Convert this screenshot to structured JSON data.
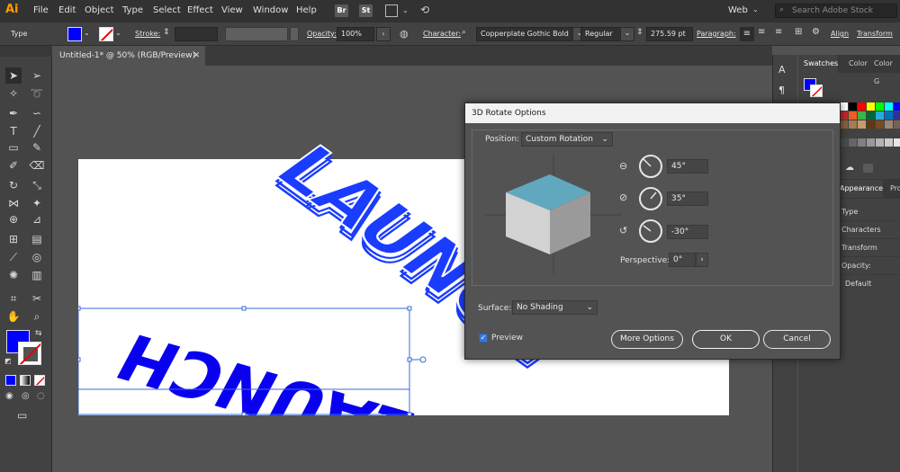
{
  "menubar": {
    "logo": "Ai",
    "items": [
      "File",
      "Edit",
      "Object",
      "Type",
      "Select",
      "Effect",
      "View",
      "Window",
      "Help"
    ],
    "bridge": "Br",
    "stock": "St",
    "workspace": "Web",
    "search_placeholder": "Search Adobe Stock"
  },
  "controlbar": {
    "selection_type": "Type",
    "stroke_label": "Stroke:",
    "opacity_label": "Opacity:",
    "opacity_value": "100%",
    "character_label": "Character:",
    "font_family": "Copperplate Gothic Bold",
    "font_style": "Regular",
    "font_size": "275.59 pt",
    "paragraph_label": "Paragraph:",
    "align_label": "Align",
    "transform_label": "Transform",
    "fill_color": "#0000ff"
  },
  "document": {
    "tab_title": "Untitled-1* @ 50% (RGB/Preview)",
    "tab_close": "✕"
  },
  "artwork": {
    "rotated_text": "LAUNCH",
    "flat_text": "LAUNCH",
    "text_color": "#1a3cff"
  },
  "right_panel": {
    "tabs": [
      "Swatches",
      "Color",
      "Color G"
    ],
    "tabs2": [
      "Appearance",
      "Pro"
    ],
    "rows": [
      "Type",
      "Characters",
      "Transform",
      "Opacity:"
    ],
    "opacity_value": "Default"
  },
  "dialog": {
    "title": "3D Rotate Options",
    "position_label": "Position:",
    "position_value": "Custom Rotation",
    "x_angle": "45°",
    "y_angle": "35°",
    "z_angle": "-30°",
    "perspective_label": "Perspective:",
    "perspective_value": "0°",
    "surface_label": "Surface:",
    "surface_value": "No Shading",
    "preview_label": "Preview",
    "preview_checked": true,
    "more_options": "More Options",
    "ok": "OK",
    "cancel": "Cancel"
  }
}
